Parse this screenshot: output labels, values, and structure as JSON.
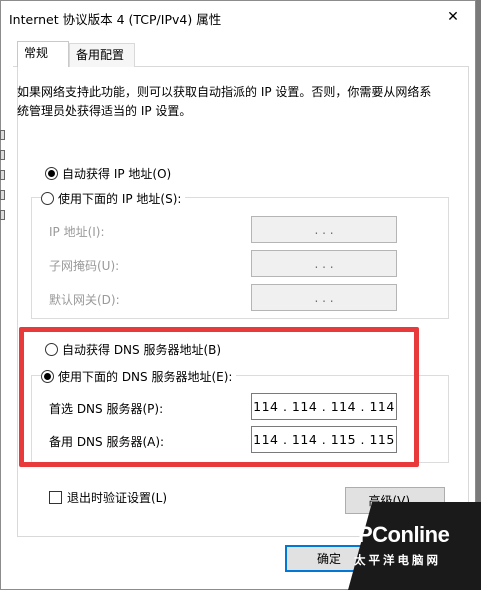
{
  "window": {
    "title": "Internet 协议版本 4 (TCP/IPv4) 属性",
    "close_glyph": "✕"
  },
  "tabs": [
    {
      "label": "常规",
      "active": true
    },
    {
      "label": "备用配置",
      "active": false
    }
  ],
  "description": "如果网络支持此功能，则可以获取自动指派的 IP 设置。否则，你需要从网络系统管理员处获得适当的 IP 设置。",
  "ip_mode": {
    "auto_label": "自动获得 IP 地址(O)",
    "manual_label": "使用下面的 IP 地址(S):",
    "selected": "auto",
    "fields": [
      {
        "label": "IP 地址(I):",
        "value": ". . ."
      },
      {
        "label": "子网掩码(U):",
        "value": ". . ."
      },
      {
        "label": "默认网关(D):",
        "value": ". . ."
      }
    ]
  },
  "dns_mode": {
    "auto_label": "自动获得 DNS 服务器地址(B)",
    "manual_label": "使用下面的 DNS 服务器地址(E):",
    "selected": "manual",
    "preferred_label": "首选 DNS 服务器(P):",
    "preferred_value": "114 . 114 . 114 . 114",
    "alternate_label": "备用 DNS 服务器(A):",
    "alternate_value": "114 . 114 . 115 . 115"
  },
  "validate_label": "退出时验证设置(L)",
  "advanced_label": "高级(V)...",
  "ok_label": "确定",
  "watermark": {
    "brand": "PConline",
    "sub": "太平洋电脑网"
  },
  "colors": {
    "highlight": "#e8393b",
    "accent": "#0078d7"
  }
}
